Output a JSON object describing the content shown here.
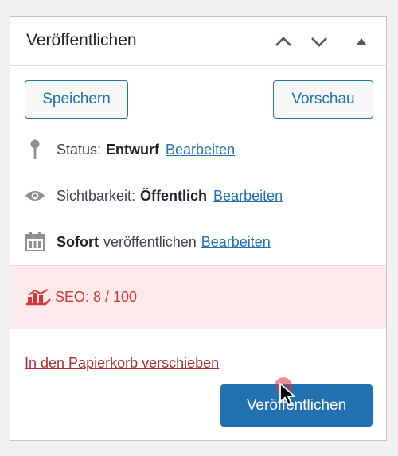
{
  "header": {
    "title": "Veröffentlichen",
    "move_up_icon": "chevron-up-icon",
    "move_down_icon": "chevron-down-icon",
    "toggle_icon": "triangle-up-icon"
  },
  "actions": {
    "save_label": "Speichern",
    "preview_label": "Vorschau"
  },
  "status": {
    "icon": "pin-icon",
    "label": "Status:",
    "value": "Entwurf",
    "edit_label": "Bearbeiten"
  },
  "visibility": {
    "icon": "eye-icon",
    "label": "Sichtbarkeit:",
    "value": "Öffentlich",
    "edit_label": "Bearbeiten"
  },
  "schedule": {
    "icon": "calendar-icon",
    "value": "Sofort",
    "label": "veröffentlichen",
    "edit_label": "Bearbeiten"
  },
  "seo": {
    "icon": "seo-chart-icon",
    "text": "SEO: 8 / 100"
  },
  "footer": {
    "trash_label": "In den Papierkorb verschieben",
    "publish_label": "Veröffentlichen"
  },
  "colors": {
    "accent": "#2271b1",
    "danger": "#d63638",
    "trash": "#b32d2e",
    "seo_bg": "#fce9e9"
  }
}
